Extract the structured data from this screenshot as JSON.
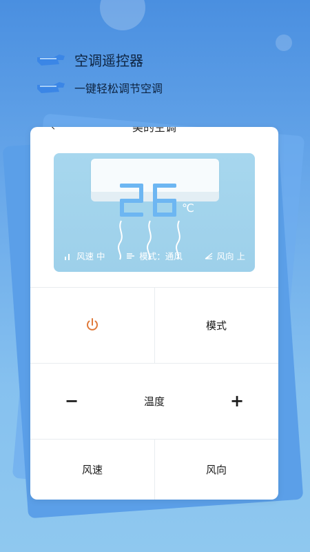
{
  "header": {
    "line1": "空调遥控器",
    "line2": "一键轻松调节空调"
  },
  "card": {
    "title": "美的空调",
    "back": "‹"
  },
  "display": {
    "temperature": "26",
    "unit": "℃",
    "status": {
      "fan_speed": "风速 中",
      "mode": "模式：通风",
      "direction": "风向 上"
    }
  },
  "controls": {
    "power": "power-icon",
    "mode": "模式",
    "minus": "−",
    "temperature": "温度",
    "plus": "+",
    "fan_speed": "风速",
    "direction": "风向"
  },
  "colors": {
    "accent": "#e07a3a",
    "bg_top": "#4a8fe0",
    "bg_bottom": "#8fc8ef",
    "display_bg": "#a7d7ee",
    "digit": "#6db6f2"
  }
}
